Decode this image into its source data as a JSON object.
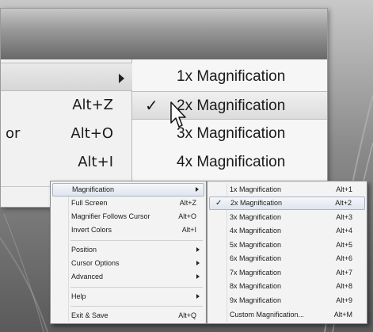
{
  "colors": {
    "menu_bg": "#f3f3f3",
    "highlight_bg": "#dfe5ee",
    "highlight_border": "#a8b4c6",
    "text": "#1b1b1b"
  },
  "zoomed_view": {
    "left_items": [
      {
        "label": "",
        "shortcut": "",
        "has_submenu": true
      },
      {
        "label": "",
        "shortcut": "Alt+Z"
      },
      {
        "label": "or",
        "shortcut": "Alt+O"
      },
      {
        "label": "",
        "shortcut": "Alt+I"
      }
    ],
    "right_items": [
      {
        "label": "1x Magnification",
        "checked": false
      },
      {
        "label": "2x Magnification",
        "checked": true
      },
      {
        "label": "3x Magnification",
        "checked": false
      },
      {
        "label": "4x Magnification",
        "checked": false
      }
    ],
    "check_glyph": "✓"
  },
  "context_menu": {
    "items": [
      {
        "label": "Magnification",
        "shortcut": "",
        "has_submenu": true,
        "highlighted": true
      },
      {
        "label": "Full Screen",
        "shortcut": "Alt+Z"
      },
      {
        "label": "Magnifier Follows Cursor",
        "shortcut": "Alt+O"
      },
      {
        "label": "Invert Colors",
        "shortcut": "Alt+I"
      },
      {
        "label": "Position",
        "shortcut": "",
        "has_submenu": true
      },
      {
        "label": "Cursor Options",
        "shortcut": "",
        "has_submenu": true
      },
      {
        "label": "Advanced",
        "shortcut": "",
        "has_submenu": true
      },
      {
        "label": "Help",
        "shortcut": "",
        "has_submenu": true
      },
      {
        "label": "Exit  & Save",
        "shortcut": "Alt+Q"
      }
    ]
  },
  "magnification_submenu": {
    "check_glyph": "✓",
    "items": [
      {
        "label": "1x Magnification",
        "shortcut": "Alt+1",
        "checked": false
      },
      {
        "label": "2x Magnification",
        "shortcut": "Alt+2",
        "checked": true
      },
      {
        "label": "3x Magnification",
        "shortcut": "Alt+3",
        "checked": false
      },
      {
        "label": "4x Magnification",
        "shortcut": "Alt+4",
        "checked": false
      },
      {
        "label": "5x Magnification",
        "shortcut": "Alt+5",
        "checked": false
      },
      {
        "label": "6x Magnification",
        "shortcut": "Alt+6",
        "checked": false
      },
      {
        "label": "7x Magnification",
        "shortcut": "Alt+7",
        "checked": false
      },
      {
        "label": "8x Magnification",
        "shortcut": "Alt+8",
        "checked": false
      },
      {
        "label": "9x Magnification",
        "shortcut": "Alt+9",
        "checked": false
      },
      {
        "label": "Custom Magnification...",
        "shortcut": "Alt+M",
        "checked": false
      }
    ]
  }
}
